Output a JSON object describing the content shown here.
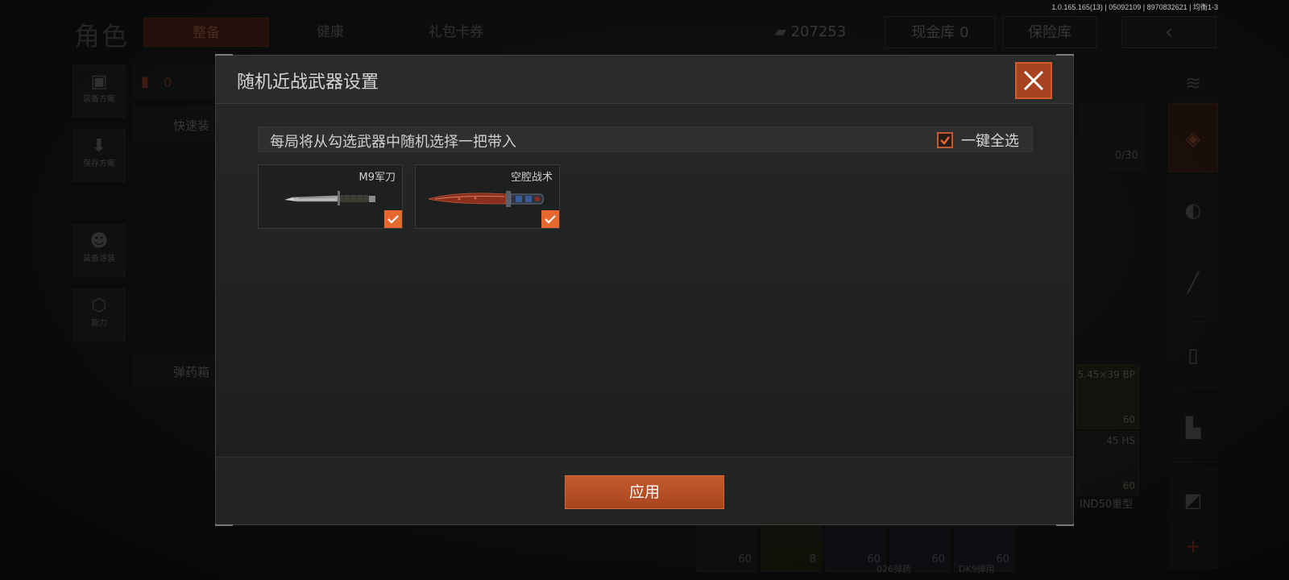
{
  "version_info": "1.0.165.165(13) | 05092109 | 8970832621 | 均衡1-3",
  "background": {
    "role_title": "角色",
    "tabs": [
      "整备",
      "健康",
      "礼包卡券"
    ],
    "money": "207253",
    "cash_vault": "现金库 0",
    "insurance_vault": "保险库",
    "left_menu": [
      "装备方案",
      "保存方案",
      "装备涂装",
      "能力"
    ],
    "quick_equip": "快速装",
    "ammo_box": "弹药箱",
    "armor_count": "0",
    "capacity": "0/30",
    "ammo_items": [
      {
        "name": "5.45×39 BP",
        "count": "60"
      },
      {
        "name": ".45 HS",
        "count": "60"
      }
    ],
    "helmet_label": "IND50重型",
    "slot_counts": [
      "60",
      "8",
      "60",
      "60",
      "60"
    ],
    "bottom_labels": [
      "026弹药",
      "DK9弹用"
    ]
  },
  "modal": {
    "title": "随机近战武器设置",
    "info_text": "每局将从勾选武器中随机选择一把带入",
    "select_all_label": "一键全选",
    "select_all_checked": true,
    "weapons": [
      {
        "name": "M9军刀",
        "checked": true
      },
      {
        "name": "空腔战术",
        "checked": true
      }
    ],
    "apply_label": "应用"
  },
  "colors": {
    "accent": "#e6682e",
    "close_bg": "#a8431f",
    "apply_bg": "#b24d24"
  }
}
